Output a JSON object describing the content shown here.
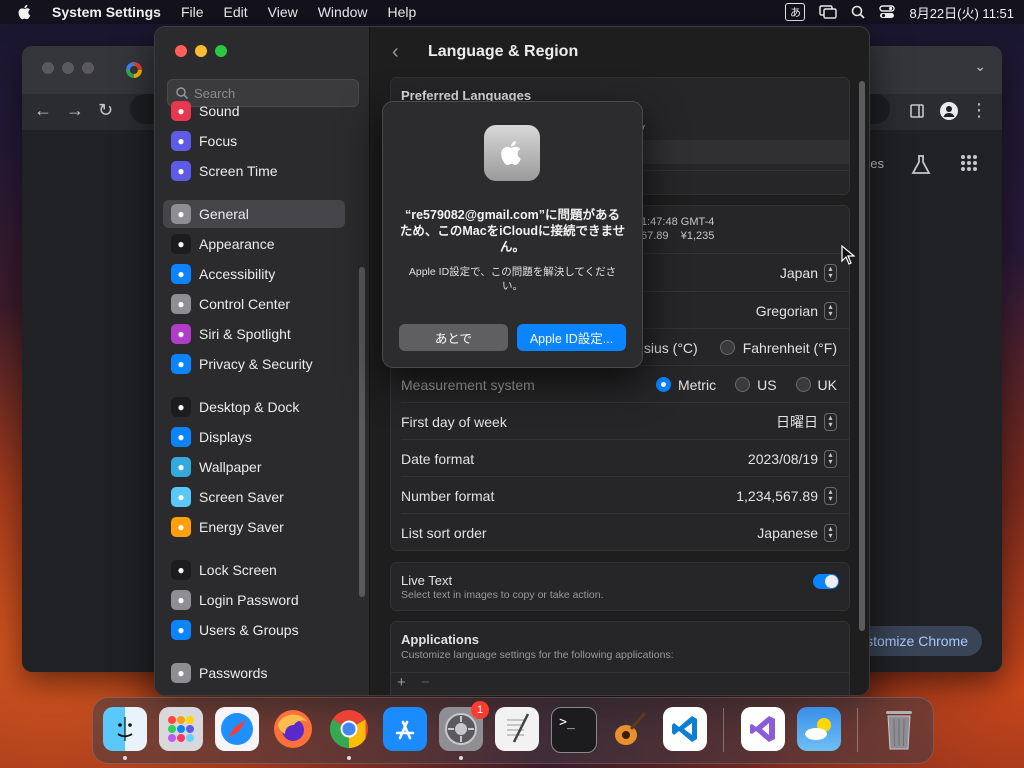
{
  "menubar": {
    "app_name": "System Settings",
    "menus": [
      "File",
      "Edit",
      "View",
      "Window",
      "Help"
    ],
    "input_method": "あ",
    "datetime": "8月22日(火) 11:51"
  },
  "chrome": {
    "partial_text": "ges",
    "customize_label": "ustomize Chrome"
  },
  "settings": {
    "search_placeholder": "Search",
    "sidebar": [
      {
        "label": "Sound",
        "icon": "speaker-icon",
        "color": "#e8384f"
      },
      {
        "label": "Focus",
        "icon": "moon-icon",
        "color": "#5e5ce6"
      },
      {
        "label": "Screen Time",
        "icon": "hourglass-icon",
        "color": "#5e5ce6"
      },
      {
        "label": "General",
        "icon": "gear-icon",
        "color": "#8e8e93",
        "selected": true
      },
      {
        "label": "Appearance",
        "icon": "appearance-icon",
        "color": "#1c1c1e"
      },
      {
        "label": "Accessibility",
        "icon": "accessibility-icon",
        "color": "#0a84ff"
      },
      {
        "label": "Control Center",
        "icon": "control-center-icon",
        "color": "#8e8e93"
      },
      {
        "label": "Siri & Spotlight",
        "icon": "siri-icon",
        "color": "#b03cc8"
      },
      {
        "label": "Privacy & Security",
        "icon": "hand-icon",
        "color": "#0a84ff"
      },
      {
        "label": "Desktop & Dock",
        "icon": "dock-icon",
        "color": "#1c1c1e"
      },
      {
        "label": "Displays",
        "icon": "sun-icon",
        "color": "#0a84ff"
      },
      {
        "label": "Wallpaper",
        "icon": "wallpaper-icon",
        "color": "#34aadc"
      },
      {
        "label": "Screen Saver",
        "icon": "screensaver-icon",
        "color": "#5ac8fa"
      },
      {
        "label": "Energy Saver",
        "icon": "bulb-icon",
        "color": "#ff9f0a"
      },
      {
        "label": "Lock Screen",
        "icon": "lock-icon",
        "color": "#1c1c1e"
      },
      {
        "label": "Login Password",
        "icon": "padlock-icon",
        "color": "#8e8e93"
      },
      {
        "label": "Users & Groups",
        "icon": "users-icon",
        "color": "#0a84ff"
      },
      {
        "label": "Passwords",
        "icon": "key-icon",
        "color": "#8e8e93"
      }
    ],
    "title": "Language & Region",
    "preferred_languages": "Preferred Languages",
    "partial_ary": "ary",
    "partial_time": "1:47:48 GMT-4",
    "partial_numbers": "67.89    ¥1,235",
    "region_value": "Japan",
    "calendar_value": "Gregorian",
    "temp_celsius": "Celsius (°C)",
    "temp_fahrenheit": "Fahrenheit (°F)",
    "measurement_label": "Measurement system",
    "measurement_options": [
      "Metric",
      "US",
      "UK"
    ],
    "first_day_label": "First day of week",
    "first_day_value": "日曜日",
    "date_format_label": "Date format",
    "date_format_value": "2023/08/19",
    "number_format_label": "Number format",
    "number_format_value": "1,234,567.89",
    "sort_order_label": "List sort order",
    "sort_order_value": "Japanese",
    "live_text_title": "Live Text",
    "live_text_desc": "Select text in images to copy or take action.",
    "applications_title": "Applications",
    "applications_desc": "Customize language settings for the following applications:",
    "add_btn": "+",
    "remove_btn": "−"
  },
  "alert": {
    "title": "“re579082@gmail.com”に問題があるため、このMacをiCloudに接続できません。",
    "message": "Apple ID設定で、この問題を解決してください。",
    "later_label": "あとで",
    "settings_label": "Apple ID設定..."
  },
  "dock": {
    "badge_count": "1"
  }
}
